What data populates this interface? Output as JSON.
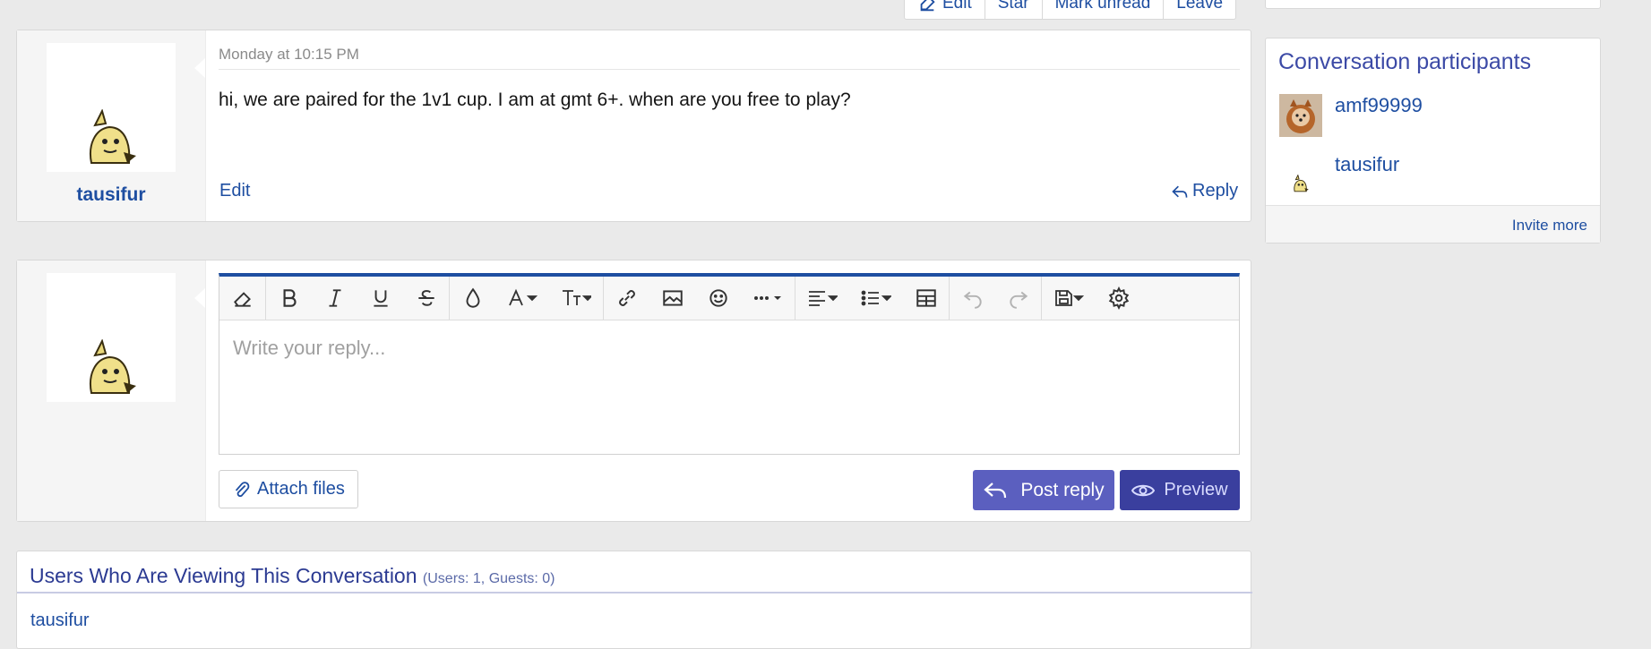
{
  "top_actions": [
    {
      "label": "Edit",
      "icon": "edit-icon"
    },
    {
      "label": "Star",
      "icon": ""
    },
    {
      "label": "Mark unread",
      "icon": ""
    },
    {
      "label": "Leave",
      "icon": ""
    }
  ],
  "message": {
    "username": "tausifur",
    "date": "Monday at 10:15 PM",
    "body": "hi, we are paired for the 1v1 cup. I am at gmt 6+. when are you free to play?",
    "edit_label": "Edit",
    "reply_label": "Reply"
  },
  "reply_form": {
    "placeholder": "Write your reply...",
    "attach_label": "Attach files",
    "post_label": "Post reply",
    "preview_label": "Preview",
    "toolbar": [
      "eraser-icon",
      "bold-icon",
      "italic-icon",
      "underline-icon",
      "strikethrough-icon",
      "color-icon",
      "font-family-icon",
      "font-size-icon",
      "link-icon",
      "image-icon",
      "smiley-icon",
      "more-icon",
      "align-icon",
      "list-icon",
      "table-icon",
      "undo-icon",
      "redo-icon",
      "drafts-icon",
      "settings-icon"
    ]
  },
  "viewers": {
    "title": "Users Who Are Viewing This Conversation",
    "counts": "(Users: 1, Guests: 0)",
    "users": [
      "tausifur"
    ]
  },
  "sidebar": {
    "title": "Conversation participants",
    "participants": [
      {
        "name": "amf99999"
      },
      {
        "name": "tausifur"
      }
    ],
    "invite_label": "Invite more"
  },
  "colors": {
    "link": "#1e4ea1",
    "primary_button": "#5b5fbf",
    "preview_button": "#3a3f9e",
    "page_bg": "#eaeaea"
  }
}
